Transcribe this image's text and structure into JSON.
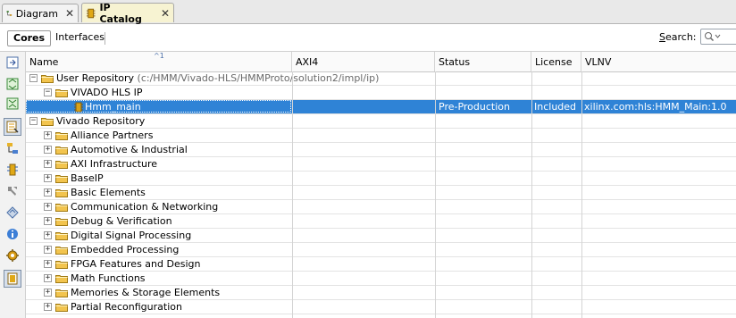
{
  "tabs": [
    {
      "label": "Diagram",
      "icon": "diagram-icon",
      "active": false
    },
    {
      "label": "IP Catalog",
      "icon": "ip-catalog-icon",
      "active": true
    }
  ],
  "close_glyph": "✕",
  "toolbar": {
    "cores_label": "Cores",
    "interfaces_label": "Interfaces",
    "search_label_prefix": "S",
    "search_label_rest": "earch:",
    "search_value": ""
  },
  "table": {
    "sort_indicator": "^1",
    "columns": [
      "Name",
      "AXI4",
      "Status",
      "License",
      "VLNV"
    ],
    "rows": [
      {
        "name": "User Repository",
        "path": "(c:/HMM/Vivado-HLS/HMMProto/solution2/impl/ip)",
        "level": 0,
        "expander": "−",
        "axi4": "",
        "status": "",
        "license": "",
        "vlnv": ""
      },
      {
        "name": "VIVADO HLS IP",
        "level": 1,
        "expander": "−",
        "axi4": "",
        "status": "",
        "license": "",
        "vlnv": ""
      },
      {
        "name": "Hmm_main",
        "level": 2,
        "selected": true,
        "axi4": "",
        "status": "Pre-Production",
        "license": "Included",
        "vlnv": "xilinx.com:hls:HMM_Main:1.0"
      },
      {
        "name": "Vivado Repository",
        "level": 0,
        "expander": "−",
        "axi4": "",
        "status": "",
        "license": "",
        "vlnv": ""
      },
      {
        "name": "Alliance Partners",
        "level": 1,
        "expander": "+"
      },
      {
        "name": "Automotive & Industrial",
        "level": 1,
        "expander": "+"
      },
      {
        "name": "AXI Infrastructure",
        "level": 1,
        "expander": "+"
      },
      {
        "name": "BaseIP",
        "level": 1,
        "expander": "+"
      },
      {
        "name": "Basic Elements",
        "level": 1,
        "expander": "+"
      },
      {
        "name": "Communication & Networking",
        "level": 1,
        "expander": "+"
      },
      {
        "name": "Debug & Verification",
        "level": 1,
        "expander": "+"
      },
      {
        "name": "Digital Signal Processing",
        "level": 1,
        "expander": "+"
      },
      {
        "name": "Embedded Processing",
        "level": 1,
        "expander": "+"
      },
      {
        "name": "FPGA Features and Design",
        "level": 1,
        "expander": "+"
      },
      {
        "name": "Math Functions",
        "level": 1,
        "expander": "+"
      },
      {
        "name": "Memories & Storage Elements",
        "level": 1,
        "expander": "+"
      },
      {
        "name": "Partial Reconfiguration",
        "level": 1,
        "expander": "+"
      }
    ]
  },
  "side_toolbar": [
    {
      "icon": "collapse-all-icon"
    },
    {
      "icon": "expand-all-icon"
    },
    {
      "icon": "expand-collapse-icon"
    },
    {
      "icon": "group-by-category-icon",
      "selected": true
    },
    {
      "icon": "hierarchy-icon"
    },
    {
      "icon": "customize-ip-icon"
    },
    {
      "icon": "wrench-icon"
    },
    {
      "icon": "package-ip-icon"
    },
    {
      "icon": "ip-details-icon"
    },
    {
      "icon": "ip-settings-icon"
    },
    {
      "icon": "ip-properties-icon",
      "selected": true
    }
  ],
  "colors": {
    "selection": "#2f83d6",
    "active_tab": "#f7f3d2",
    "folder": "#f2c44e",
    "ip_icon": "#d8a21a"
  }
}
